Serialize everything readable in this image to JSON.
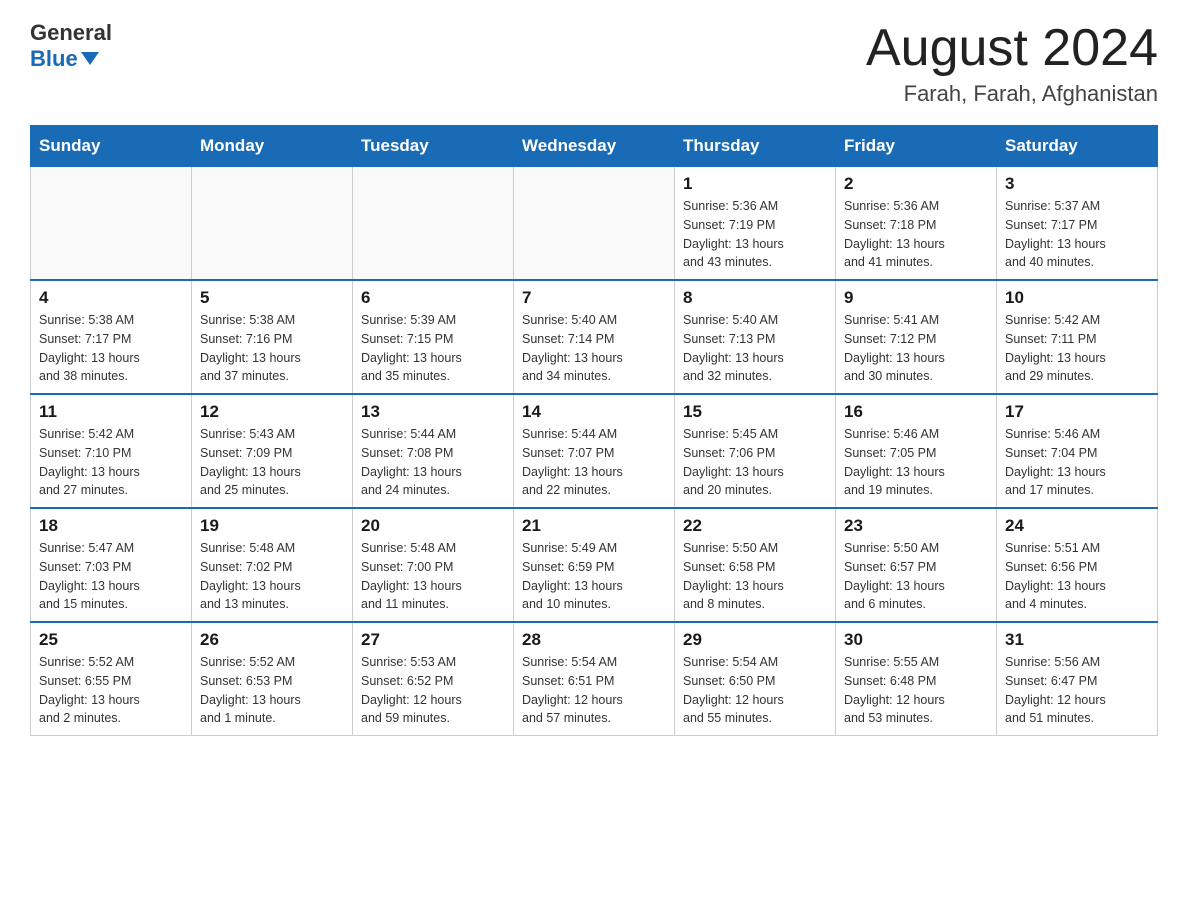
{
  "header": {
    "logo_general": "General",
    "logo_blue": "Blue",
    "main_title": "August 2024",
    "sub_title": "Farah, Farah, Afghanistan"
  },
  "calendar": {
    "days_of_week": [
      "Sunday",
      "Monday",
      "Tuesday",
      "Wednesday",
      "Thursday",
      "Friday",
      "Saturday"
    ],
    "weeks": [
      [
        {
          "day": "",
          "info": ""
        },
        {
          "day": "",
          "info": ""
        },
        {
          "day": "",
          "info": ""
        },
        {
          "day": "",
          "info": ""
        },
        {
          "day": "1",
          "info": "Sunrise: 5:36 AM\nSunset: 7:19 PM\nDaylight: 13 hours\nand 43 minutes."
        },
        {
          "day": "2",
          "info": "Sunrise: 5:36 AM\nSunset: 7:18 PM\nDaylight: 13 hours\nand 41 minutes."
        },
        {
          "day": "3",
          "info": "Sunrise: 5:37 AM\nSunset: 7:17 PM\nDaylight: 13 hours\nand 40 minutes."
        }
      ],
      [
        {
          "day": "4",
          "info": "Sunrise: 5:38 AM\nSunset: 7:17 PM\nDaylight: 13 hours\nand 38 minutes."
        },
        {
          "day": "5",
          "info": "Sunrise: 5:38 AM\nSunset: 7:16 PM\nDaylight: 13 hours\nand 37 minutes."
        },
        {
          "day": "6",
          "info": "Sunrise: 5:39 AM\nSunset: 7:15 PM\nDaylight: 13 hours\nand 35 minutes."
        },
        {
          "day": "7",
          "info": "Sunrise: 5:40 AM\nSunset: 7:14 PM\nDaylight: 13 hours\nand 34 minutes."
        },
        {
          "day": "8",
          "info": "Sunrise: 5:40 AM\nSunset: 7:13 PM\nDaylight: 13 hours\nand 32 minutes."
        },
        {
          "day": "9",
          "info": "Sunrise: 5:41 AM\nSunset: 7:12 PM\nDaylight: 13 hours\nand 30 minutes."
        },
        {
          "day": "10",
          "info": "Sunrise: 5:42 AM\nSunset: 7:11 PM\nDaylight: 13 hours\nand 29 minutes."
        }
      ],
      [
        {
          "day": "11",
          "info": "Sunrise: 5:42 AM\nSunset: 7:10 PM\nDaylight: 13 hours\nand 27 minutes."
        },
        {
          "day": "12",
          "info": "Sunrise: 5:43 AM\nSunset: 7:09 PM\nDaylight: 13 hours\nand 25 minutes."
        },
        {
          "day": "13",
          "info": "Sunrise: 5:44 AM\nSunset: 7:08 PM\nDaylight: 13 hours\nand 24 minutes."
        },
        {
          "day": "14",
          "info": "Sunrise: 5:44 AM\nSunset: 7:07 PM\nDaylight: 13 hours\nand 22 minutes."
        },
        {
          "day": "15",
          "info": "Sunrise: 5:45 AM\nSunset: 7:06 PM\nDaylight: 13 hours\nand 20 minutes."
        },
        {
          "day": "16",
          "info": "Sunrise: 5:46 AM\nSunset: 7:05 PM\nDaylight: 13 hours\nand 19 minutes."
        },
        {
          "day": "17",
          "info": "Sunrise: 5:46 AM\nSunset: 7:04 PM\nDaylight: 13 hours\nand 17 minutes."
        }
      ],
      [
        {
          "day": "18",
          "info": "Sunrise: 5:47 AM\nSunset: 7:03 PM\nDaylight: 13 hours\nand 15 minutes."
        },
        {
          "day": "19",
          "info": "Sunrise: 5:48 AM\nSunset: 7:02 PM\nDaylight: 13 hours\nand 13 minutes."
        },
        {
          "day": "20",
          "info": "Sunrise: 5:48 AM\nSunset: 7:00 PM\nDaylight: 13 hours\nand 11 minutes."
        },
        {
          "day": "21",
          "info": "Sunrise: 5:49 AM\nSunset: 6:59 PM\nDaylight: 13 hours\nand 10 minutes."
        },
        {
          "day": "22",
          "info": "Sunrise: 5:50 AM\nSunset: 6:58 PM\nDaylight: 13 hours\nand 8 minutes."
        },
        {
          "day": "23",
          "info": "Sunrise: 5:50 AM\nSunset: 6:57 PM\nDaylight: 13 hours\nand 6 minutes."
        },
        {
          "day": "24",
          "info": "Sunrise: 5:51 AM\nSunset: 6:56 PM\nDaylight: 13 hours\nand 4 minutes."
        }
      ],
      [
        {
          "day": "25",
          "info": "Sunrise: 5:52 AM\nSunset: 6:55 PM\nDaylight: 13 hours\nand 2 minutes."
        },
        {
          "day": "26",
          "info": "Sunrise: 5:52 AM\nSunset: 6:53 PM\nDaylight: 13 hours\nand 1 minute."
        },
        {
          "day": "27",
          "info": "Sunrise: 5:53 AM\nSunset: 6:52 PM\nDaylight: 12 hours\nand 59 minutes."
        },
        {
          "day": "28",
          "info": "Sunrise: 5:54 AM\nSunset: 6:51 PM\nDaylight: 12 hours\nand 57 minutes."
        },
        {
          "day": "29",
          "info": "Sunrise: 5:54 AM\nSunset: 6:50 PM\nDaylight: 12 hours\nand 55 minutes."
        },
        {
          "day": "30",
          "info": "Sunrise: 5:55 AM\nSunset: 6:48 PM\nDaylight: 12 hours\nand 53 minutes."
        },
        {
          "day": "31",
          "info": "Sunrise: 5:56 AM\nSunset: 6:47 PM\nDaylight: 12 hours\nand 51 minutes."
        }
      ]
    ]
  }
}
